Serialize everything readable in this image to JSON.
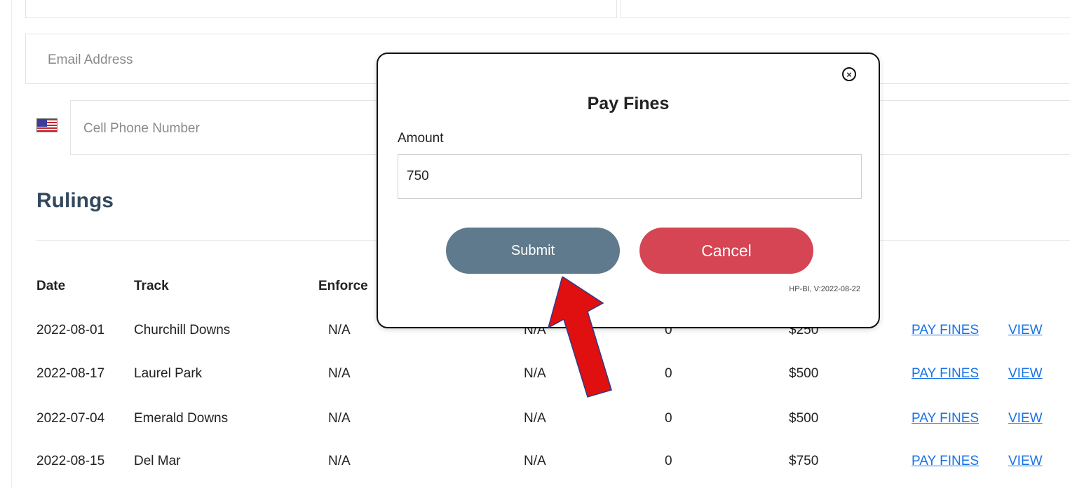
{
  "form": {
    "email_placeholder": "Email Address",
    "phone_placeholder": "Cell Phone Number",
    "flag_icon": "us-flag-icon"
  },
  "rulings": {
    "title": "Rulings",
    "columns": [
      "Date",
      "Track",
      "Enforce"
    ],
    "rows": [
      {
        "date": "2022-08-01",
        "track": "Churchill Downs",
        "col3": "N/A",
        "col4": "N/A",
        "col5": "0",
        "fine": "$250",
        "pay_link": "PAY FINES",
        "view_link": "VIEW"
      },
      {
        "date": "2022-08-17",
        "track": "Laurel Park",
        "col3": "N/A",
        "col4": "N/A",
        "col5": "0",
        "fine": "$500",
        "pay_link": "PAY FINES",
        "view_link": "VIEW"
      },
      {
        "date": "2022-07-04",
        "track": "Emerald Downs",
        "col3": "N/A",
        "col4": "N/A",
        "col5": "0",
        "fine": "$500",
        "pay_link": "PAY FINES",
        "view_link": "VIEW"
      },
      {
        "date": "2022-08-15",
        "track": "Del Mar",
        "col3": "N/A",
        "col4": "N/A",
        "col5": "0",
        "fine": "$750",
        "pay_link": "PAY FINES",
        "view_link": "VIEW"
      }
    ]
  },
  "modal": {
    "close_glyph": "×",
    "title": "Pay Fines",
    "amount_label": "Amount",
    "amount_value": "750",
    "submit_label": "Submit",
    "cancel_label": "Cancel",
    "version": "HP-BI, V:2022-08-22"
  },
  "colors": {
    "heading": "#34495e",
    "link": "#1a73e8",
    "submit": "#5f7a8c",
    "cancel": "#d54553",
    "arrow": "#e01010"
  }
}
